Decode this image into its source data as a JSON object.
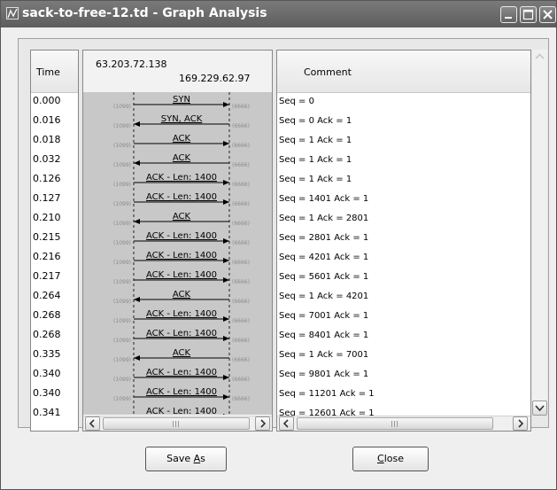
{
  "window": {
    "title": "sack-to-free-12.td - Graph Analysis"
  },
  "titlebar_buttons": [
    "minimize-icon",
    "maximize-icon",
    "close-icon"
  ],
  "time_panel": {
    "header": "Time",
    "rows": [
      "0.000",
      "0.016",
      "0.018",
      "0.032",
      "0.126",
      "0.127",
      "0.210",
      "0.215",
      "0.216",
      "0.217",
      "0.264",
      "0.268",
      "0.268",
      "0.335",
      "0.340",
      "0.340",
      "0.341"
    ]
  },
  "flow_panel": {
    "host_a": "63.203.72.138",
    "host_b": "169.229.62.97",
    "port_a": "(1099)",
    "port_b": "(6666)",
    "rows": [
      {
        "label": "SYN",
        "direction": "right"
      },
      {
        "label": "SYN, ACK",
        "direction": "left"
      },
      {
        "label": "ACK",
        "direction": "right"
      },
      {
        "label": "ACK",
        "direction": "left"
      },
      {
        "label": "ACK - Len: 1400",
        "direction": "right"
      },
      {
        "label": "ACK - Len: 1400",
        "direction": "right"
      },
      {
        "label": "ACK",
        "direction": "left"
      },
      {
        "label": "ACK - Len: 1400",
        "direction": "right"
      },
      {
        "label": "ACK - Len: 1400",
        "direction": "right"
      },
      {
        "label": "ACK - Len: 1400",
        "direction": "right"
      },
      {
        "label": "ACK",
        "direction": "left"
      },
      {
        "label": "ACK - Len: 1400",
        "direction": "right"
      },
      {
        "label": "ACK - Len: 1400",
        "direction": "right"
      },
      {
        "label": "ACK",
        "direction": "left"
      },
      {
        "label": "ACK - Len: 1400",
        "direction": "right"
      },
      {
        "label": "ACK - Len: 1400",
        "direction": "right"
      },
      {
        "label": "ACK - Len: 1400",
        "direction": "right"
      }
    ]
  },
  "comment_panel": {
    "header": "Comment",
    "rows": [
      "Seq = 0",
      "Seq = 0 Ack = 1",
      "Seq = 1 Ack = 1",
      "Seq = 1 Ack = 1",
      "Seq = 1 Ack = 1",
      "Seq = 1401 Ack = 1",
      "Seq = 1 Ack = 2801",
      "Seq = 2801 Ack = 1",
      "Seq = 4201 Ack = 1",
      "Seq = 5601 Ack = 1",
      "Seq = 1 Ack = 4201",
      "Seq = 7001 Ack = 1",
      "Seq = 8401 Ack = 1",
      "Seq = 1 Ack = 7001",
      "Seq = 9801 Ack = 1",
      "Seq = 11201 Ack = 1",
      "Seq = 12601 Ack = 1"
    ]
  },
  "buttons": {
    "save": {
      "text": "Save ",
      "mnemonic": "A",
      "suffix": "s"
    },
    "close": {
      "mnemonic": "C",
      "text": "lose"
    }
  },
  "colors": {
    "titlebar": "#6a6a6a",
    "flow_background": "#c8c8c8",
    "port_text": "#8a8a8a"
  }
}
